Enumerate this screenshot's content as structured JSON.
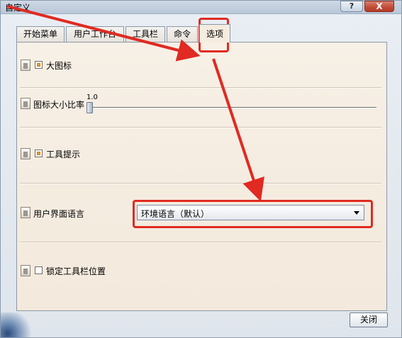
{
  "window": {
    "title": "自定义",
    "help_label": "?",
    "close_label": "X"
  },
  "tabs": [
    {
      "label": "开始菜单"
    },
    {
      "label": "用户工作台"
    },
    {
      "label": "工具栏"
    },
    {
      "label": "命令"
    },
    {
      "label": "选项"
    }
  ],
  "options": {
    "large_icons_label": "大图标",
    "icon_scale_label": "图标大小比率",
    "icon_scale_value": "1.0",
    "tooltips_label": "工具提示",
    "ui_language_label": "用户界面语言",
    "ui_language_selected": "环境语言（默认）",
    "lock_toolbar_label": "锁定工具栏位置"
  },
  "footer": {
    "close_button_label": "关闭"
  },
  "colors": {
    "annotation_red": "#e02a22",
    "checkbox_orange": "#e9a22f"
  }
}
